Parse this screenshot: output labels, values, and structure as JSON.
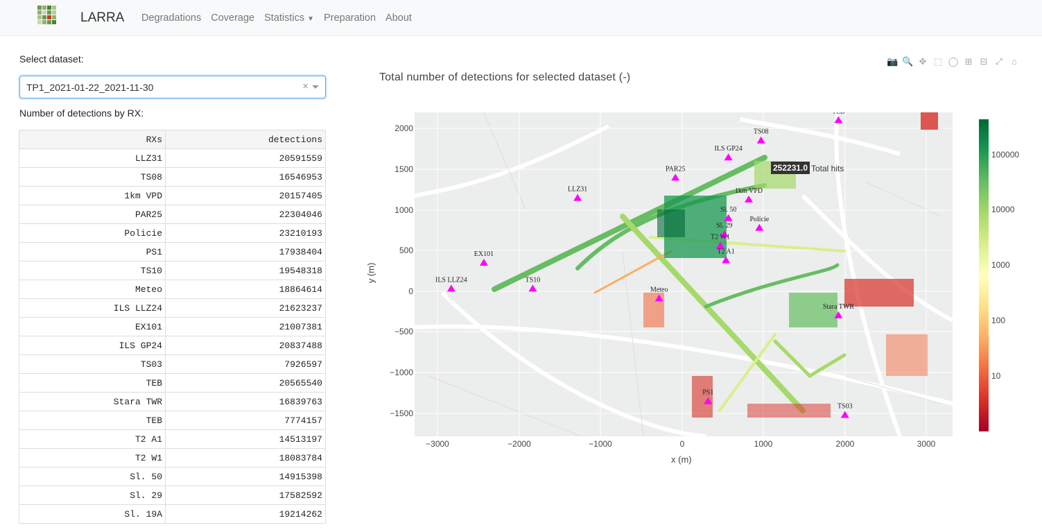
{
  "app": {
    "brand": "LARRA",
    "nav": [
      {
        "label": "Degradations"
      },
      {
        "label": "Coverage"
      },
      {
        "label": "Statistics"
      },
      {
        "label": "Preparation"
      },
      {
        "label": "About"
      }
    ]
  },
  "controls": {
    "select_label": "Select dataset:",
    "dataset_value": "TP1_2021-01-22_2021-11-30",
    "clear_icon": "×",
    "table_label": "Number of detections by RX:"
  },
  "table": {
    "headers": [
      "RXs",
      "detections"
    ],
    "rows": [
      [
        "LLZ31",
        "20591559"
      ],
      [
        "TS08",
        "16546953"
      ],
      [
        "1km VPD",
        "20157405"
      ],
      [
        "PAR25",
        "22304046"
      ],
      [
        "Policie",
        "23210193"
      ],
      [
        "PS1",
        "17938404"
      ],
      [
        "TS10",
        "19548318"
      ],
      [
        "Meteo",
        "18864614"
      ],
      [
        "ILS LLZ24",
        "21623237"
      ],
      [
        "EX101",
        "21007381"
      ],
      [
        "ILS GP24",
        "20837488"
      ],
      [
        "TS03",
        "7926597"
      ],
      [
        "TEB",
        "20565540"
      ],
      [
        "Stara TWR",
        "16839763"
      ],
      [
        "TEB",
        "7774157"
      ],
      [
        "T2 A1",
        "14513197"
      ],
      [
        "T2 W1",
        "18083784"
      ],
      [
        "Sl. 50",
        "14915398"
      ],
      [
        "Sl. 29",
        "17582592"
      ],
      [
        "Sl. 19A",
        "19214262"
      ]
    ]
  },
  "plot": {
    "title": "Total number of detections for selected dataset (-)",
    "xlabel": "x (m)",
    "ylabel": "y (m)",
    "hover_value": "252231.0",
    "hover_label": "Total hits",
    "modebar": [
      "camera-icon",
      "zoom-icon",
      "pan-icon",
      "box-select-icon",
      "lasso-icon",
      "zoom-in-icon",
      "zoom-out-icon",
      "autoscale-icon",
      "home-icon"
    ],
    "colors": {
      "high": "#006837",
      "mid": "#ffffbf",
      "low": "#a50026",
      "marker": "#ff00ff"
    }
  },
  "chart_data": {
    "type": "heatmap",
    "title": "Total number of detections for selected dataset (-)",
    "xlabel": "x (m)",
    "ylabel": "y (m)",
    "xlim": [
      -3300,
      3300
    ],
    "ylim": [
      -1800,
      2200
    ],
    "x_ticks": [
      "−3000",
      "−2000",
      "−1000",
      "0",
      "1000",
      "2000",
      "3000"
    ],
    "y_ticks": [
      "2000",
      "1500",
      "1000",
      "500",
      "0",
      "−500",
      "−1000",
      "−1500"
    ],
    "colorbar_ticks": [
      "100000",
      "10000",
      "1000",
      "100",
      "10"
    ],
    "colorscale": "log, red-yellow-green",
    "markers": [
      {
        "name": "LLZ31",
        "x": -1300,
        "y": 1150
      },
      {
        "name": "EX101",
        "x": -2450,
        "y": 350
      },
      {
        "name": "ILS LLZ24",
        "x": -2850,
        "y": 30
      },
      {
        "name": "TS10",
        "x": -1850,
        "y": 30
      },
      {
        "name": "PAR25",
        "x": -100,
        "y": 1400
      },
      {
        "name": "ILS GP24",
        "x": 550,
        "y": 1650
      },
      {
        "name": "TS08",
        "x": 950,
        "y": 1860
      },
      {
        "name": "Policie",
        "x": 930,
        "y": 780
      },
      {
        "name": "Meteo",
        "x": -300,
        "y": -90
      },
      {
        "name": "Stara TWR",
        "x": 1900,
        "y": -300
      },
      {
        "name": "PS1",
        "x": 300,
        "y": -1360
      },
      {
        "name": "TS03",
        "x": 1980,
        "y": -1530
      },
      {
        "name": "TEB",
        "x": 1900,
        "y": 2110
      },
      {
        "name": "1km VPD",
        "x": 800,
        "y": 1130
      },
      {
        "name": "Sl. 50",
        "x": 550,
        "y": 900
      },
      {
        "name": "Sl. 29",
        "x": 500,
        "y": 700
      },
      {
        "name": "T2 W1",
        "x": 450,
        "y": 560
      },
      {
        "name": "T2 A1",
        "x": 520,
        "y": 380
      }
    ]
  }
}
